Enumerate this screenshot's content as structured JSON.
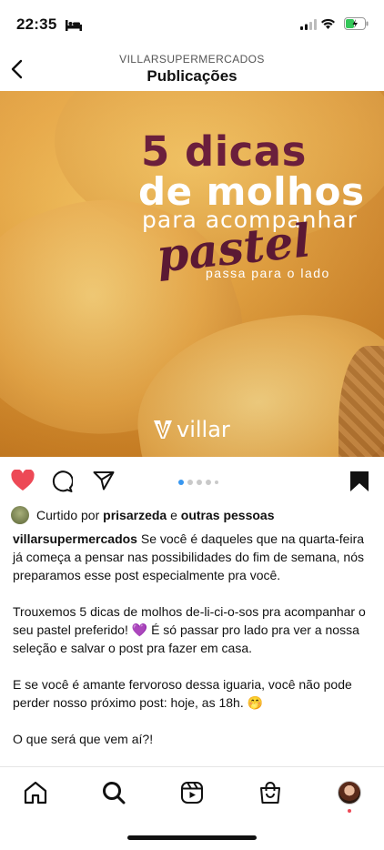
{
  "status_bar": {
    "time": "22:35"
  },
  "header": {
    "account": "VILLARSUPERMERCADOS",
    "title": "Publicações"
  },
  "post": {
    "image_text": {
      "line1": "5 dicas",
      "line2": "de molhos",
      "line3": "para acompanhar",
      "line4": "pastel",
      "line5": "passa para o lado"
    },
    "brand": "villar",
    "carousel_dots": 5,
    "active_dot": 1
  },
  "likes": {
    "prefix": "Curtido por ",
    "user": "prisarzeda",
    "joiner": " e ",
    "others": "outras pessoas"
  },
  "caption": {
    "username": "villarsupermercados",
    "p1": " Se você é daqueles que na quarta-feira já começa a pensar nas possibilidades do fim de semana, nós preparamos esse post especialmente pra você.",
    "p2a": "Trouxemos 5 dicas de molhos de-li-ci-o-sos pra acompanhar o seu pastel preferido! ",
    "p2_emoji": "💜",
    "p2b": "  É só passar pro lado pra ver a nossa seleção e salvar o post pra fazer em casa.",
    "p3": "E se você é amante fervoroso dessa iguaria, você não pode perder nosso próximo post: hoje, as 18h. 🤭",
    "p4": "O que será que vem aí?!"
  },
  "colors": {
    "like_red": "#ed4956",
    "dot_active": "#3897f0",
    "headline_wine": "#6b1f3c"
  },
  "nav": {
    "items": [
      "home-icon",
      "search-icon",
      "reels-icon",
      "shop-icon",
      "profile-avatar"
    ]
  }
}
